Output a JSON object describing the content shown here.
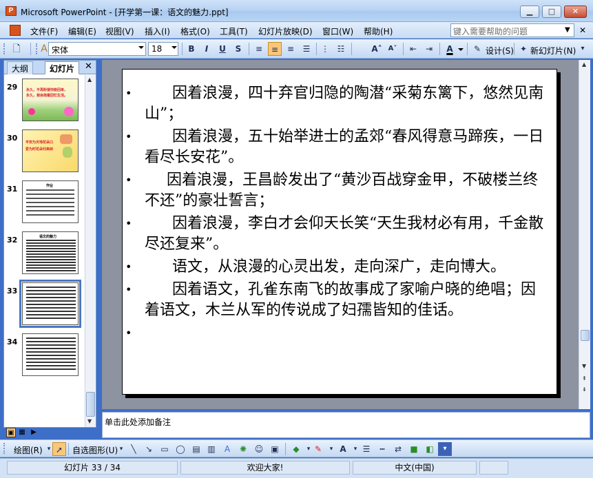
{
  "window": {
    "app_icon": "P",
    "title": "Microsoft PowerPoint - [开学第一课：语文的魅力.ppt]",
    "min": "▁",
    "max": "□",
    "close": "✕"
  },
  "menu": {
    "items": [
      "文件(F)",
      "编辑(E)",
      "视图(V)",
      "插入(I)",
      "格式(O)",
      "工具(T)",
      "幻灯片放映(D)",
      "窗口(W)",
      "帮助(H)"
    ],
    "help_placeholder": "键入需要帮助的问题"
  },
  "formatting": {
    "font": "宋体",
    "size": "18",
    "bold": "B",
    "italic": "I",
    "underline": "U",
    "shadow": "S",
    "design_label": "设计(S)",
    "new_slide_label": "新幻灯片(N)"
  },
  "panel": {
    "tab_outline": "大纲",
    "tab_slides": "幻灯片",
    "close": "✕"
  },
  "thumbnails": [
    {
      "num": "29",
      "lines": [
        "永久，不再盼望你能回来，",
        "永久，我会抱着回忆生活。"
      ],
      "theme": "green"
    },
    {
      "num": "30",
      "lines": [
        "平安为天地花朵口",
        "爱为时花朵归来树"
      ],
      "theme": "yellow"
    },
    {
      "num": "31",
      "lines": [
        "作业"
      ],
      "theme": "text"
    },
    {
      "num": "32",
      "lines": [
        "语文的魅力"
      ],
      "theme": "text"
    },
    {
      "num": "33",
      "lines": [],
      "theme": "text",
      "selected": true
    },
    {
      "num": "34",
      "lines": [],
      "theme": "text"
    }
  ],
  "slide": {
    "bullet": "•",
    "bullets": [
      "因着浪漫，四十弃官归隐的陶潜“采菊东篱下，悠然见南山”；",
      "因着浪漫，五十始举进士的孟郊“春风得意马蹄疾，一日看尽长安花”。",
      "因着浪漫，王昌龄发出了“黄沙百战穿金甲，不破楼兰终不还”的豪壮誓言；",
      "因着浪漫，李白才会仰天长笑“天生我材必有用，千金散尽还复来”。",
      "语文，从浪漫的心灵出发，走向深广，走向博大。",
      "因着语文，孔雀东南飞的故事成了家喻户晓的绝唱；因着语文，木兰从军的传说成了妇孺皆知的佳话。",
      ""
    ]
  },
  "notes": {
    "placeholder": "单击此处添加备注"
  },
  "drawing": {
    "draw_label": "绘图(R)",
    "autoshapes_label": "自选图形(U)"
  },
  "status": {
    "slide_info": "幻灯片 33 / 34",
    "design": "欢迎大家!",
    "language": "中文(中国)"
  }
}
